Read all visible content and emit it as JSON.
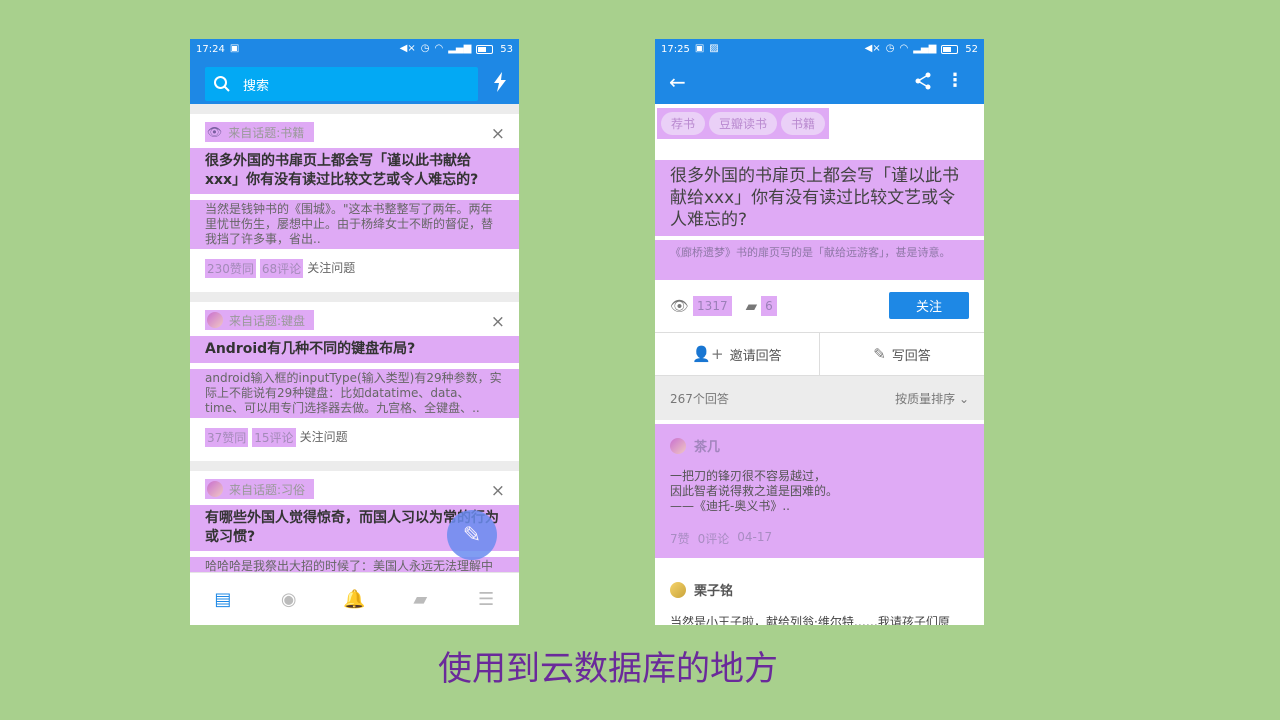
{
  "left": {
    "status": {
      "time": "17:24",
      "battery": "53"
    },
    "search": {
      "placeholder": "搜索"
    },
    "cards": [
      {
        "topic": "来自话题:书籍",
        "title": "很多外国的书扉页上都会写「谨以此书献给xxx」你有没有读过比较文艺或令人难忘的?",
        "excerpt": "当然是钱钟书的《围城》。\"这本书整整写了两年。两年里忧世伤生，屡想中止。由于杨绛女士不断的督促，替我挡了许多事，省出..",
        "votes": "230赞同",
        "comments": "68评论",
        "follow": "关注问题"
      },
      {
        "topic": "来自话题:键盘",
        "title": "Android有几种不同的键盘布局?",
        "excerpt": "android输入框的inputType(输入类型)有29种参数，实际上不能说有29种键盘：比如datatime、data、time、可以用专门选择器去做。九宫格、全键盘、..",
        "votes": "37赞同",
        "comments": "15评论",
        "follow": "关注问题"
      },
      {
        "topic": "来自话题:习俗",
        "title": "有哪些外国人觉得惊奇，而国人习以为常的行为或习惯?",
        "excerpt": "哈哈哈是我祭出大招的时候了：美国人永远无法理解中国人对于洗碗机天然的不信任。ABC有一部美剧叫",
        "votes": "",
        "comments": "",
        "follow": ""
      }
    ],
    "nav": [
      "feed-icon",
      "compass-icon",
      "bell-icon",
      "chat-icon",
      "menu-icon"
    ]
  },
  "right": {
    "status": {
      "time": "17:25",
      "battery": "52"
    },
    "tags": [
      "荐书",
      "豆瓣读书",
      "书籍"
    ],
    "question_title": "很多外国的书扉页上都会写「谨以此书献给xxx」你有没有读过比较文艺或令人难忘的?",
    "question_desc": "《廊桥遗梦》书的扉页写的是「献给远游客」，甚是诗意。",
    "views": "1317",
    "comments": "6",
    "follow_label": "关注",
    "invite_label": "邀请回答",
    "write_label": "写回答",
    "answer_count": "267个回答",
    "sort_label": "按质量排序",
    "answers": [
      {
        "author": "茶几",
        "content_lines": [
          "一把刀的锋刃很不容易越过，",
          "因此智者说得救之道是困难的。",
          "——《迪托-奥义书》.."
        ],
        "votes": "7赞",
        "comments": "0评论",
        "date": "04-17"
      },
      {
        "author": "栗子铭",
        "content": "当然是小王子啦，献给列翁·维尔特……我请孩子们原"
      }
    ]
  },
  "caption": "使用到云数据库的地方",
  "colors": {
    "primary": "#1e88e5",
    "highlight": "#dfaaf5",
    "background": "#a8d08d",
    "caption": "#6a2a9a"
  }
}
